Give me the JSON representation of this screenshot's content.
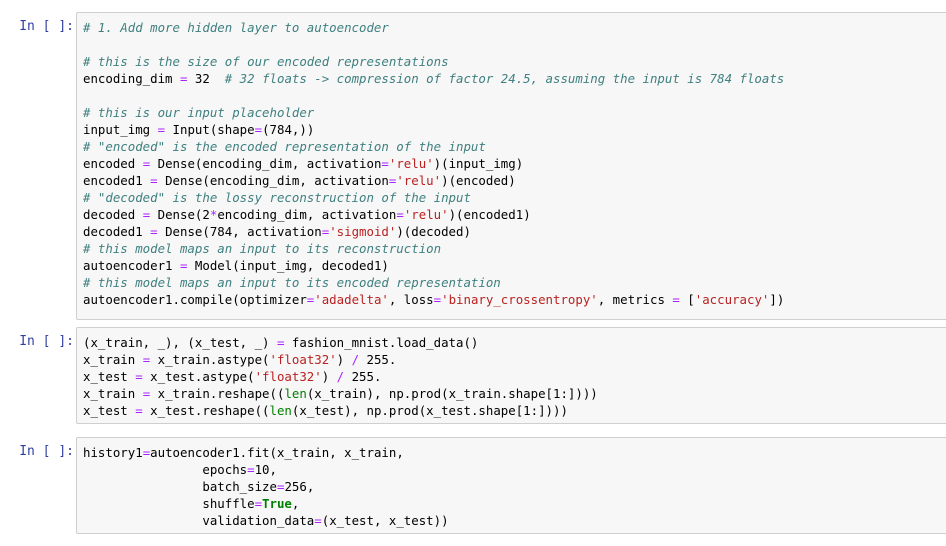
{
  "cells": [
    {
      "prompt": "In [ ]:",
      "lines": [
        [
          {
            "t": "cm",
            "v": "# 1. Add more hidden layer to autoencoder"
          }
        ],
        [],
        [
          {
            "t": "cm",
            "v": "# this is the size of our encoded representations"
          }
        ],
        [
          {
            "t": "n",
            "v": "encoding_dim "
          },
          {
            "t": "o",
            "v": "="
          },
          {
            "t": "n",
            "v": " 32  "
          },
          {
            "t": "cm",
            "v": "# 32 floats -> compression of factor 24.5, assuming the input is 784 floats"
          }
        ],
        [],
        [
          {
            "t": "cm",
            "v": "# this is our input placeholder"
          }
        ],
        [
          {
            "t": "n",
            "v": "input_img "
          },
          {
            "t": "o",
            "v": "="
          },
          {
            "t": "n",
            "v": " Input(shape"
          },
          {
            "t": "o",
            "v": "="
          },
          {
            "t": "n",
            "v": "(784,))"
          }
        ],
        [
          {
            "t": "cm",
            "v": "# \"encoded\" is the encoded representation of the input"
          }
        ],
        [
          {
            "t": "n",
            "v": "encoded "
          },
          {
            "t": "o",
            "v": "="
          },
          {
            "t": "n",
            "v": " Dense(encoding_dim, activation"
          },
          {
            "t": "o",
            "v": "="
          },
          {
            "t": "s",
            "v": "'relu'"
          },
          {
            "t": "n",
            "v": ")(input_img)"
          }
        ],
        [
          {
            "t": "n",
            "v": "encoded1 "
          },
          {
            "t": "o",
            "v": "="
          },
          {
            "t": "n",
            "v": " Dense(encoding_dim, activation"
          },
          {
            "t": "o",
            "v": "="
          },
          {
            "t": "s",
            "v": "'relu'"
          },
          {
            "t": "n",
            "v": ")(encoded)"
          }
        ],
        [
          {
            "t": "cm",
            "v": "# \"decoded\" is the lossy reconstruction of the input"
          }
        ],
        [
          {
            "t": "n",
            "v": "decoded "
          },
          {
            "t": "o",
            "v": "="
          },
          {
            "t": "n",
            "v": " Dense(2"
          },
          {
            "t": "o",
            "v": "*"
          },
          {
            "t": "n",
            "v": "encoding_dim, activation"
          },
          {
            "t": "o",
            "v": "="
          },
          {
            "t": "s",
            "v": "'relu'"
          },
          {
            "t": "n",
            "v": ")(encoded1)"
          }
        ],
        [
          {
            "t": "n",
            "v": "decoded1 "
          },
          {
            "t": "o",
            "v": "="
          },
          {
            "t": "n",
            "v": " Dense(784, activation"
          },
          {
            "t": "o",
            "v": "="
          },
          {
            "t": "s",
            "v": "'sigmoid'"
          },
          {
            "t": "n",
            "v": ")(decoded)"
          }
        ],
        [
          {
            "t": "cm",
            "v": "# this model maps an input to its reconstruction"
          }
        ],
        [
          {
            "t": "n",
            "v": "autoencoder1 "
          },
          {
            "t": "o",
            "v": "="
          },
          {
            "t": "n",
            "v": " Model(input_img, decoded1)"
          }
        ],
        [
          {
            "t": "cm",
            "v": "# this model maps an input to its encoded representation"
          }
        ],
        [
          {
            "t": "n",
            "v": "autoencoder1.compile(optimizer"
          },
          {
            "t": "o",
            "v": "="
          },
          {
            "t": "s",
            "v": "'adadelta'"
          },
          {
            "t": "n",
            "v": ", loss"
          },
          {
            "t": "o",
            "v": "="
          },
          {
            "t": "s",
            "v": "'binary_crossentropy'"
          },
          {
            "t": "n",
            "v": ", metrics "
          },
          {
            "t": "o",
            "v": "="
          },
          {
            "t": "n",
            "v": " ["
          },
          {
            "t": "s",
            "v": "'accuracy'"
          },
          {
            "t": "n",
            "v": "])"
          }
        ]
      ]
    },
    {
      "prompt": "In [ ]:",
      "lines": [
        [
          {
            "t": "n",
            "v": "(x_train, _), (x_test, _) "
          },
          {
            "t": "o",
            "v": "="
          },
          {
            "t": "n",
            "v": " fashion_mnist.load_data()"
          }
        ],
        [
          {
            "t": "n",
            "v": "x_train "
          },
          {
            "t": "o",
            "v": "="
          },
          {
            "t": "n",
            "v": " x_train.astype("
          },
          {
            "t": "s",
            "v": "'float32'"
          },
          {
            "t": "n",
            "v": ") "
          },
          {
            "t": "o",
            "v": "/"
          },
          {
            "t": "n",
            "v": " 255."
          }
        ],
        [
          {
            "t": "n",
            "v": "x_test "
          },
          {
            "t": "o",
            "v": "="
          },
          {
            "t": "n",
            "v": " x_test.astype("
          },
          {
            "t": "s",
            "v": "'float32'"
          },
          {
            "t": "n",
            "v": ") "
          },
          {
            "t": "o",
            "v": "/"
          },
          {
            "t": "n",
            "v": " 255."
          }
        ],
        [
          {
            "t": "n",
            "v": "x_train "
          },
          {
            "t": "o",
            "v": "="
          },
          {
            "t": "n",
            "v": " x_train.reshape(("
          },
          {
            "t": "bi",
            "v": "len"
          },
          {
            "t": "n",
            "v": "(x_train), np.prod(x_train.shape[1:])))"
          }
        ],
        [
          {
            "t": "n",
            "v": "x_test "
          },
          {
            "t": "o",
            "v": "="
          },
          {
            "t": "n",
            "v": " x_test.reshape(("
          },
          {
            "t": "bi",
            "v": "len"
          },
          {
            "t": "n",
            "v": "(x_test), np.prod(x_test.shape[1:])))"
          }
        ]
      ]
    },
    {
      "prompt": "In [ ]:",
      "lines": [
        [
          {
            "t": "n",
            "v": "history1"
          },
          {
            "t": "o",
            "v": "="
          },
          {
            "t": "n",
            "v": "autoencoder1.fit(x_train, x_train,"
          }
        ],
        [
          {
            "t": "n",
            "v": "                epochs"
          },
          {
            "t": "o",
            "v": "="
          },
          {
            "t": "n",
            "v": "10,"
          }
        ],
        [
          {
            "t": "n",
            "v": "                batch_size"
          },
          {
            "t": "o",
            "v": "="
          },
          {
            "t": "n",
            "v": "256,"
          }
        ],
        [
          {
            "t": "n",
            "v": "                shuffle"
          },
          {
            "t": "o",
            "v": "="
          },
          {
            "t": "kw",
            "v": "True"
          },
          {
            "t": "n",
            "v": ","
          }
        ],
        [
          {
            "t": "n",
            "v": "                validation_data"
          },
          {
            "t": "o",
            "v": "="
          },
          {
            "t": "n",
            "v": "(x_test, x_test))"
          }
        ]
      ]
    }
  ]
}
